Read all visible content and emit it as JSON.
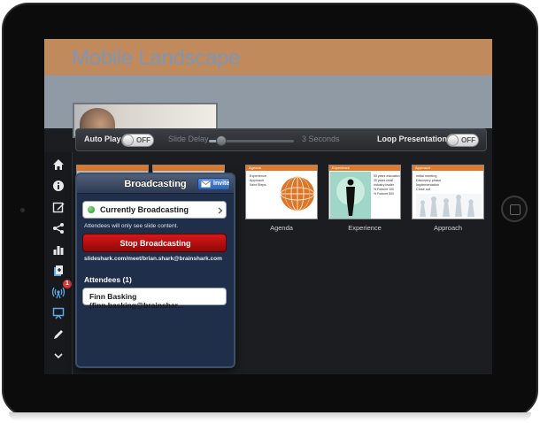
{
  "slide": {
    "title": "Mobile Landscape"
  },
  "toolbar": {
    "auto_play_label": "Auto Play",
    "auto_play_state": "OFF",
    "slide_delay_label": "Slide Delay",
    "slide_delay_value": "3 Seconds",
    "slide_delay_fraction": 0.15,
    "loop_label": "Loop Presentation",
    "loop_state": "OFF"
  },
  "sidebar": {
    "items": [
      {
        "icon": "home-icon"
      },
      {
        "icon": "info-icon"
      },
      {
        "icon": "edit-icon"
      },
      {
        "icon": "share-icon"
      },
      {
        "icon": "analytics-icon"
      },
      {
        "icon": "add-document-icon"
      },
      {
        "icon": "broadcast-icon",
        "badge": "1"
      },
      {
        "icon": "presentation-icon"
      },
      {
        "icon": "pen-icon"
      },
      {
        "icon": "chevron-down-icon"
      }
    ]
  },
  "thumbnails": [
    {
      "caption": "Agenda",
      "heading": "Agenda",
      "bullets": [
        "Experience",
        "Approach",
        "Next Steps"
      ]
    },
    {
      "caption": "Experience",
      "heading": "Experience",
      "bullets": [
        "50 years education",
        "30 years retail",
        "Industry leader",
        "% Fortune 100",
        "% Fortune 500"
      ]
    },
    {
      "caption": "Approach",
      "heading": "Approach",
      "bullets": [
        "Initial meeting",
        "Discovery phase",
        "Implementation",
        "Close out"
      ]
    }
  ],
  "popover": {
    "title": "Broadcasting",
    "invite_label": "Invite",
    "status_label": "Currently Broadcasting",
    "status_note": "Attendees will only see slide content.",
    "stop_label": "Stop Broadcasting",
    "url": "slideshark.com/meet/brian.shark@brainshark.com",
    "attendees_heading": "Attendees (1)",
    "attendees": [
      "Finn Basking (finn.basking@brainshar..."
    ]
  },
  "colors": {
    "slide_header": "#c08a5c",
    "slide_title": "#7b96b9",
    "stop_button": "#c41212",
    "popover_bg": "#1f2f4a"
  }
}
